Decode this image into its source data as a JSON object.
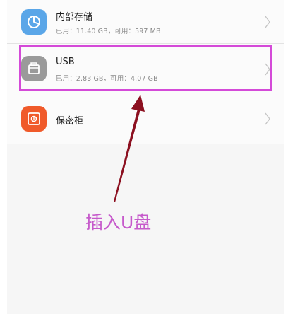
{
  "storage_list": {
    "items": [
      {
        "title": "内部存储",
        "subtitle": "已用：11.40 GB，可用：597 MB",
        "icon": "pie-chart-icon",
        "icon_color": "#5aa6e8"
      },
      {
        "title": "USB",
        "subtitle": "已用：2.83 GB，可用：4.07 GB",
        "icon": "usb-drive-icon",
        "icon_color": "#9a9a9a"
      },
      {
        "title": "保密柜",
        "icon": "safe-icon",
        "icon_color": "#f05a2a"
      }
    ]
  },
  "annotation": {
    "text": "插入U盘",
    "color": "#c65acb",
    "highlight_color": "#d44ad8",
    "arrow_color": "#8c1020"
  }
}
